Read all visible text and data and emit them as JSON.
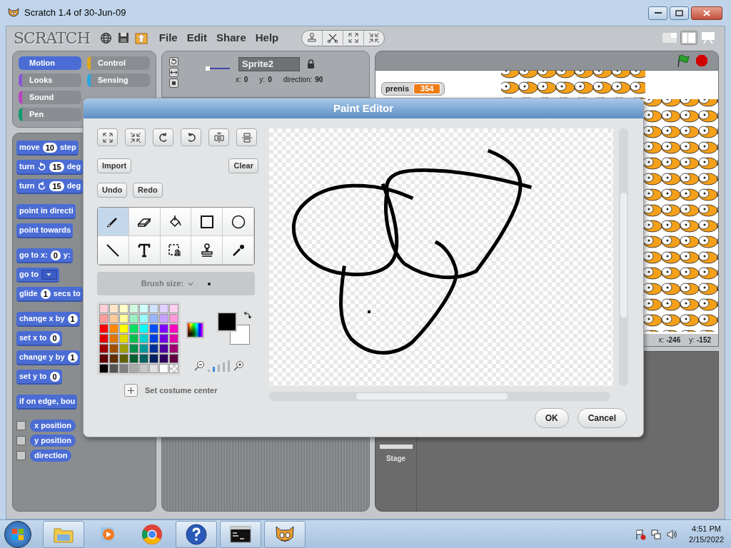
{
  "window": {
    "title": "Scratch 1.4 of 30-Jun-09"
  },
  "menu_bar": {
    "logo": "SCRATCH",
    "menus": [
      "File",
      "Edit",
      "Share",
      "Help"
    ]
  },
  "categories": [
    {
      "label": "Motion",
      "color": "#4a6cd4",
      "selected": true
    },
    {
      "label": "Looks",
      "color": "#8a55d7",
      "selected": false
    },
    {
      "label": "Sound",
      "color": "#bb42c3",
      "selected": false
    },
    {
      "label": "Pen",
      "color": "#0e9a6c",
      "selected": false
    },
    {
      "label": "Control",
      "color": "#e1a91a",
      "selected": false
    },
    {
      "label": "Sensing",
      "color": "#2ca5e2",
      "selected": false
    }
  ],
  "block_groups": [
    {
      "blocks": [
        {
          "parts": [
            {
              "kind": "text",
              "text": "move"
            },
            {
              "kind": "number",
              "text": "10"
            },
            {
              "kind": "text",
              "text": "step"
            }
          ]
        },
        {
          "parts": [
            {
              "kind": "text",
              "text": "turn"
            },
            {
              "kind": "rotate_cw"
            },
            {
              "kind": "number",
              "text": "15"
            },
            {
              "kind": "text",
              "text": "deg"
            }
          ]
        },
        {
          "parts": [
            {
              "kind": "text",
              "text": "turn"
            },
            {
              "kind": "rotate_ccw"
            },
            {
              "kind": "number",
              "text": "15"
            },
            {
              "kind": "text",
              "text": "deg"
            }
          ]
        }
      ]
    },
    {
      "blocks": [
        {
          "parts": [
            {
              "kind": "text",
              "text": "point in directi"
            }
          ]
        },
        {
          "parts": [
            {
              "kind": "text",
              "text": "point towards"
            }
          ]
        }
      ]
    },
    {
      "blocks": [
        {
          "parts": [
            {
              "kind": "text",
              "text": "go to x:"
            },
            {
              "kind": "number",
              "text": "0"
            },
            {
              "kind": "text",
              "text": "y:"
            }
          ]
        },
        {
          "parts": [
            {
              "kind": "text",
              "text": "go to"
            },
            {
              "kind": "dropdown"
            }
          ]
        },
        {
          "parts": [
            {
              "kind": "text",
              "text": "glide"
            },
            {
              "kind": "number",
              "text": "1"
            },
            {
              "kind": "text",
              "text": "secs to"
            }
          ]
        }
      ]
    },
    {
      "blocks": [
        {
          "parts": [
            {
              "kind": "text",
              "text": "change x by"
            },
            {
              "kind": "number",
              "text": "1"
            }
          ]
        },
        {
          "parts": [
            {
              "kind": "text",
              "text": "set x to"
            },
            {
              "kind": "number",
              "text": "0"
            }
          ]
        },
        {
          "parts": [
            {
              "kind": "text",
              "text": "change y by"
            },
            {
              "kind": "number",
              "text": "1"
            }
          ]
        },
        {
          "parts": [
            {
              "kind": "text",
              "text": "set y to"
            },
            {
              "kind": "number",
              "text": "0"
            }
          ]
        }
      ]
    },
    {
      "blocks": [
        {
          "parts": [
            {
              "kind": "text",
              "text": "if on edge, bou"
            }
          ]
        }
      ]
    }
  ],
  "reporters": [
    {
      "label": "x position",
      "checked": false
    },
    {
      "label": "y position",
      "checked": false
    },
    {
      "label": "direction",
      "checked": false
    }
  ],
  "sprite": {
    "name": "Sprite2",
    "fields": [
      {
        "label": "x:",
        "value": "0"
      },
      {
        "label": "y:",
        "value": "0"
      },
      {
        "label": "direction:",
        "value": "90"
      }
    ]
  },
  "stage": {
    "monitor": {
      "label": "prenis",
      "value": "354"
    },
    "mouse": [
      {
        "label": "x:",
        "value": "-246"
      },
      {
        "label": "y:",
        "value": "-152"
      }
    ]
  },
  "sprite_list": {
    "stage_label": "Stage"
  },
  "paint_editor": {
    "title": "Paint Editor",
    "import": "Import",
    "clear": "Clear",
    "undo": "Undo",
    "redo": "Redo",
    "tools": [
      {
        "selected": true
      },
      {
        "selected": false
      },
      {
        "selected": false
      },
      {
        "selected": false
      },
      {
        "selected": false
      },
      {
        "selected": false
      },
      {
        "selected": false
      },
      {
        "selected": false
      },
      {
        "selected": false
      },
      {
        "selected": false
      }
    ],
    "brush_size": {
      "label": "Brush size:"
    },
    "palette": [
      {
        "swatches": [
          {
            "kind": "solid",
            "color": "#ffd0d8"
          },
          {
            "kind": "solid",
            "color": "#ffe6c8"
          },
          {
            "kind": "solid",
            "color": "#ffffc8"
          },
          {
            "kind": "solid",
            "color": "#d0f8e0"
          },
          {
            "kind": "solid",
            "color": "#d0ffff"
          },
          {
            "kind": "solid",
            "color": "#d0e0ff"
          },
          {
            "kind": "solid",
            "color": "#e0d0ff"
          },
          {
            "kind": "solid",
            "color": "#ffd0f0"
          }
        ]
      },
      {
        "swatches": [
          {
            "kind": "solid",
            "color": "#ff9c9c"
          },
          {
            "kind": "solid",
            "color": "#ffcc99"
          },
          {
            "kind": "solid",
            "color": "#ffff99"
          },
          {
            "kind": "solid",
            "color": "#99f0c0"
          },
          {
            "kind": "solid",
            "color": "#99ffff"
          },
          {
            "kind": "solid",
            "color": "#99b4ff"
          },
          {
            "kind": "solid",
            "color": "#c8a0ff"
          },
          {
            "kind": "solid",
            "color": "#ff99d8"
          }
        ]
      },
      {
        "swatches": [
          {
            "kind": "solid",
            "color": "#ff0000"
          },
          {
            "kind": "solid",
            "color": "#ff8800"
          },
          {
            "kind": "solid",
            "color": "#ffff00"
          },
          {
            "kind": "solid",
            "color": "#00e060"
          },
          {
            "kind": "solid",
            "color": "#00ffff"
          },
          {
            "kind": "solid",
            "color": "#0050ff"
          },
          {
            "kind": "solid",
            "color": "#8000ff"
          },
          {
            "kind": "solid",
            "color": "#ff00c0"
          }
        ]
      },
      {
        "swatches": [
          {
            "kind": "solid",
            "color": "#e00000"
          },
          {
            "kind": "solid",
            "color": "#e07800"
          },
          {
            "kind": "solid",
            "color": "#e0d800"
          },
          {
            "kind": "solid",
            "color": "#00c050"
          },
          {
            "kind": "solid",
            "color": "#00d0d0"
          },
          {
            "kind": "solid",
            "color": "#0040e0"
          },
          {
            "kind": "solid",
            "color": "#7000e0"
          },
          {
            "kind": "solid",
            "color": "#e000a8"
          }
        ]
      },
      {
        "swatches": [
          {
            "kind": "solid",
            "color": "#a00000"
          },
          {
            "kind": "solid",
            "color": "#a05000"
          },
          {
            "kind": "solid",
            "color": "#a0a000"
          },
          {
            "kind": "solid",
            "color": "#00904a"
          },
          {
            "kind": "solid",
            "color": "#009898"
          },
          {
            "kind": "solid",
            "color": "#003098"
          },
          {
            "kind": "solid",
            "color": "#5000a0"
          },
          {
            "kind": "solid",
            "color": "#a00070"
          }
        ]
      },
      {
        "swatches": [
          {
            "kind": "solid",
            "color": "#600000"
          },
          {
            "kind": "solid",
            "color": "#603000"
          },
          {
            "kind": "solid",
            "color": "#606000"
          },
          {
            "kind": "solid",
            "color": "#006030"
          },
          {
            "kind": "solid",
            "color": "#006060"
          },
          {
            "kind": "solid",
            "color": "#002060"
          },
          {
            "kind": "solid",
            "color": "#300060"
          },
          {
            "kind": "solid",
            "color": "#600040"
          }
        ]
      },
      {
        "swatches": [
          {
            "kind": "solid",
            "color": "#000000"
          },
          {
            "kind": "solid",
            "color": "#555555"
          },
          {
            "kind": "solid",
            "color": "#808080"
          },
          {
            "kind": "solid",
            "color": "#aaaaaa"
          },
          {
            "kind": "solid",
            "color": "#c8c8c8"
          },
          {
            "kind": "solid",
            "color": "#e0e0e0"
          },
          {
            "kind": "solid",
            "color": "#ffffff"
          },
          {
            "kind": "transparent"
          }
        ]
      }
    ],
    "foreground": {
      "color": "#000000"
    },
    "background": {
      "color": "#ffffff"
    },
    "zoom_steps": [
      {
        "selected": false
      },
      {
        "selected": true
      },
      {
        "selected": false
      },
      {
        "selected": false
      },
      {
        "selected": false
      }
    ],
    "set_center": "Set costume center",
    "ok": "OK",
    "cancel": "Cancel"
  },
  "taskbar": {
    "apps": [
      {
        "running": true
      },
      {
        "running": false
      },
      {
        "running": false
      },
      {
        "running": true
      },
      {
        "running": true
      },
      {
        "running": true
      }
    ],
    "clock": {
      "time": "4:51 PM",
      "date": "2/15/2022"
    }
  }
}
